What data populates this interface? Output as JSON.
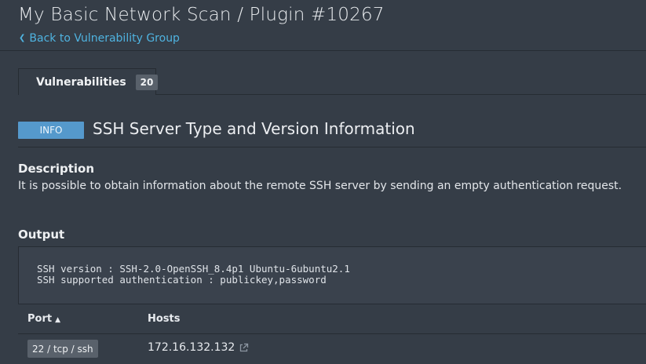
{
  "header": {
    "title": "My Basic Network Scan / Plugin #10267",
    "back_link": "Back to Vulnerability Group"
  },
  "tabs": [
    {
      "label": "Vulnerabilities",
      "count": "20"
    }
  ],
  "plugin": {
    "severity": "INFO",
    "name": "SSH Server Type and Version Information"
  },
  "description": {
    "heading": "Description",
    "text": "It is possible to obtain information about the remote SSH server by sending an empty authentication request."
  },
  "output": {
    "heading": "Output",
    "lines": [
      "SSH version : SSH-2.0-OpenSSH_8.4p1 Ubuntu-6ubuntu2.1",
      "SSH supported authentication : publickey,password"
    ]
  },
  "table": {
    "columns": [
      {
        "label": "Port",
        "sort": "▲"
      },
      {
        "label": "Hosts"
      }
    ],
    "rows": [
      {
        "port": "22 / tcp / ssh",
        "host": "172.16.132.132"
      }
    ]
  },
  "icons": {
    "back": "chevron-left-icon",
    "external": "external-link-icon"
  },
  "colors": {
    "background": "#353d47",
    "link": "#4fb3e0",
    "severity_info": "#5599cc"
  }
}
